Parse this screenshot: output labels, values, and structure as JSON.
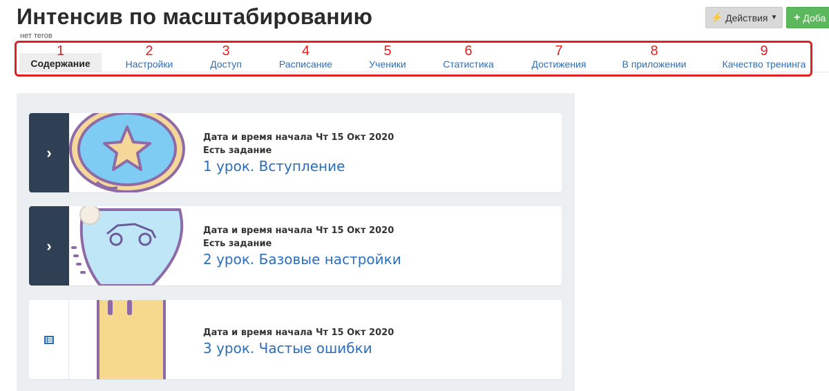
{
  "header": {
    "title": "Интенсив по масштабированию",
    "tags_note": "нет тегов",
    "actions_label": "Действия",
    "add_label": "Доба"
  },
  "tabs": [
    {
      "num": "1",
      "label": "Содержание",
      "active": true
    },
    {
      "num": "2",
      "label": "Настройки"
    },
    {
      "num": "3",
      "label": "Доступ"
    },
    {
      "num": "4",
      "label": "Расписание"
    },
    {
      "num": "5",
      "label": "Ученики"
    },
    {
      "num": "6",
      "label": "Статистика"
    },
    {
      "num": "7",
      "label": "Достижения"
    },
    {
      "num": "8",
      "label": "В приложении"
    },
    {
      "num": "9",
      "label": "Качество тренинга"
    }
  ],
  "lessons": [
    {
      "date": "Дата и время начала Чт 15 Окт 2020",
      "task": "Есть задание",
      "title": "1 урок. Вступление",
      "expander_icon": "chevron-right-icon",
      "thumb_icon": "star-badge-icon"
    },
    {
      "date": "Дата и время начала Чт 15 Окт 2020",
      "task": "Есть задание",
      "title": "2 урок. Базовые настройки",
      "expander_icon": "chevron-right-icon",
      "thumb_icon": "rocket-car-shield-icon"
    },
    {
      "date": "Дата и время начала Чт 15 Окт 2020",
      "title": "3 урок. Частые ошибки",
      "expander_icon": "list-icon",
      "thumb_icon": "ticket-icon"
    }
  ],
  "colors": {
    "accent_red": "#e02020",
    "link_blue": "#2a6ebb",
    "expander_dark": "#2f4054",
    "add_green": "#5cb85c"
  }
}
